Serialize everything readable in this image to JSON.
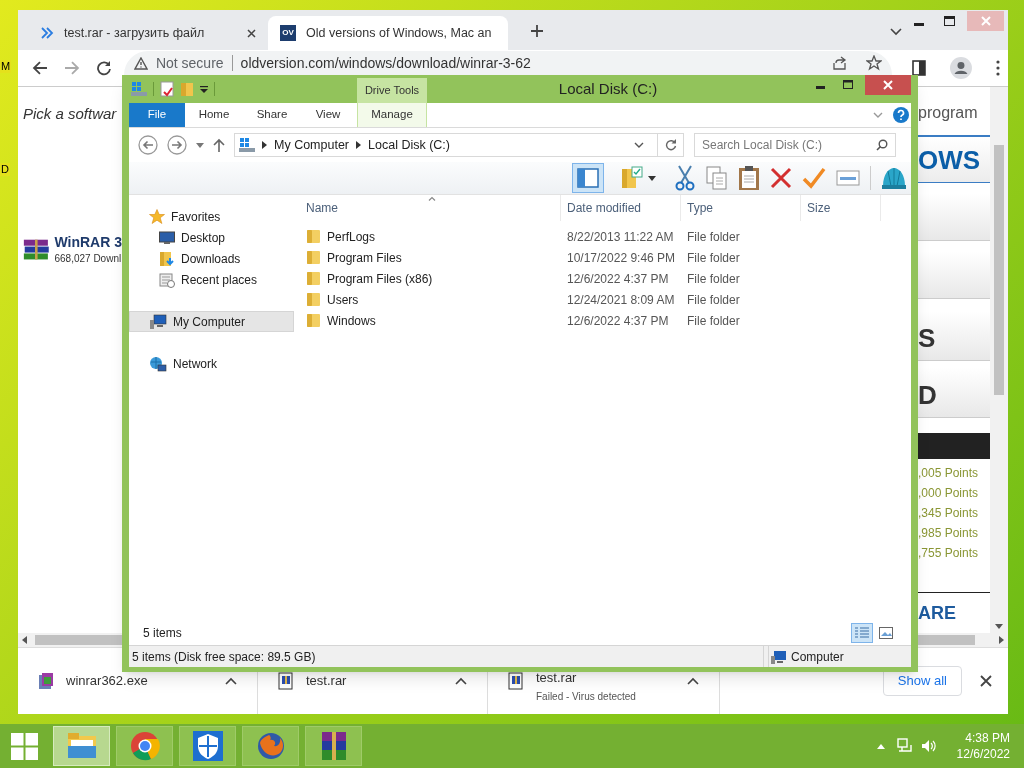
{
  "desktop": {
    "labels": [
      "M",
      "D"
    ]
  },
  "browser": {
    "tabs": [
      {
        "title": "test.rar - загрузить файл",
        "selected": false
      },
      {
        "title": "Old versions of Windows, Mac an",
        "favicon_text": "OV",
        "selected": true
      }
    ],
    "address": {
      "security": "Not secure",
      "url": "oldversion.com/windows/download/winrar-3-62"
    },
    "page": {
      "intro": "Pick a softwar",
      "app_name": "WinRAR 3",
      "app_downloads": "668,027 Downl",
      "sidebar_heading": "program",
      "banner": "OWS",
      "panels": [
        "S",
        "D"
      ],
      "points": [
        ",005 Points",
        ",000 Points",
        ",345 Points",
        ",985 Points",
        ",755 Points"
      ],
      "footer_heading": "ARE"
    },
    "downloads": [
      {
        "name": "winrar362.exe",
        "kind": "exe"
      },
      {
        "name": "test.rar",
        "kind": "rar"
      },
      {
        "name": "test.rar",
        "kind": "rar",
        "status": "Failed - Virus detected"
      }
    ],
    "show_all": "Show all"
  },
  "explorer": {
    "title": "Local Disk (C:)",
    "context_tab": "Drive Tools",
    "ribbon_tabs": [
      {
        "label": "File",
        "kind": "file"
      },
      {
        "label": "Home",
        "kind": "tab"
      },
      {
        "label": "Share",
        "kind": "tab"
      },
      {
        "label": "View",
        "kind": "tab"
      },
      {
        "label": "Manage",
        "kind": "context"
      }
    ],
    "breadcrumb": [
      "My Computer",
      "Local Disk (C:)"
    ],
    "search": {
      "placeholder": "Search Local Disk (C:)"
    },
    "preview_pane": {
      "selected": true
    },
    "nav": [
      {
        "label": "Favorites",
        "kind": "favorites",
        "selected": false,
        "children": [
          {
            "label": "Desktop",
            "kind": "desktop",
            "selected": false
          },
          {
            "label": "Downloads",
            "kind": "downloads",
            "selected": false
          },
          {
            "label": "Recent places",
            "kind": "recent",
            "selected": false
          }
        ]
      },
      {
        "label": "My Computer",
        "kind": "computer",
        "selected": true
      },
      {
        "label": "Network",
        "kind": "network",
        "selected": false
      }
    ],
    "columns": [
      "Name",
      "Date modified",
      "Type",
      "Size"
    ],
    "rows": [
      {
        "name": "PerfLogs",
        "date": "8/22/2013 11:22 AM",
        "type": "File folder"
      },
      {
        "name": "Program Files",
        "date": "10/17/2022 9:46 PM",
        "type": "File folder"
      },
      {
        "name": "Program Files (x86)",
        "date": "12/6/2022 4:37 PM",
        "type": "File folder"
      },
      {
        "name": "Users",
        "date": "12/24/2021 8:09 AM",
        "type": "File folder"
      },
      {
        "name": "Windows",
        "date": "12/6/2022 4:37 PM",
        "type": "File folder"
      }
    ],
    "item_count": "5 items",
    "views": [
      {
        "kind": "details",
        "selected": true
      },
      {
        "kind": "large-icons",
        "selected": false
      }
    ],
    "status": "5 items (Disk free space: 89.5 GB)",
    "location": "Computer"
  },
  "taskbar": {
    "apps": [
      {
        "kind": "explorer",
        "selected": true
      },
      {
        "kind": "chrome",
        "selected": false
      },
      {
        "kind": "defender",
        "selected": false
      },
      {
        "kind": "firefox",
        "selected": false
      },
      {
        "kind": "winrar",
        "selected": false
      }
    ],
    "time": "4:38 PM",
    "date": "12/6/2022"
  }
}
